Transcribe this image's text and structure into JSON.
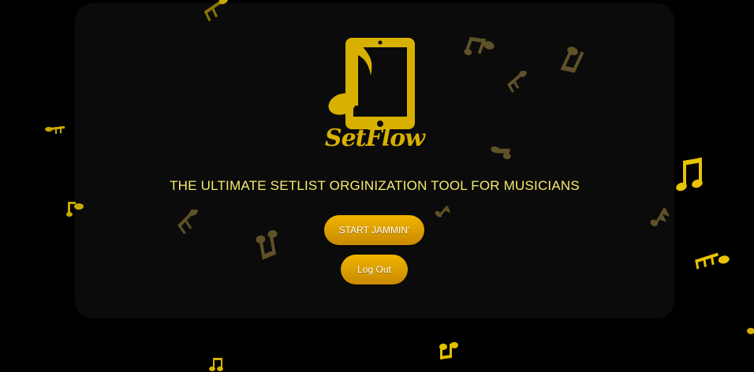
{
  "app": {
    "brand_name": "SetFlow",
    "tagline": "THE ULTIMATE SETLIST ORGINIZATION TOOL FOR MUSICIANS"
  },
  "actions": {
    "start_label": "START JAMMIN'",
    "logout_label": "Log Out"
  },
  "colors": {
    "background": "#000000",
    "card": "#0b0b0b",
    "gold": "#d8b100",
    "tagline": "#f5ec6e",
    "button_top": "#f0b400",
    "button_bottom": "#c98a00"
  },
  "icons": {
    "logo": "tablet-music-note-icon",
    "decorations": "music-note-icon"
  }
}
